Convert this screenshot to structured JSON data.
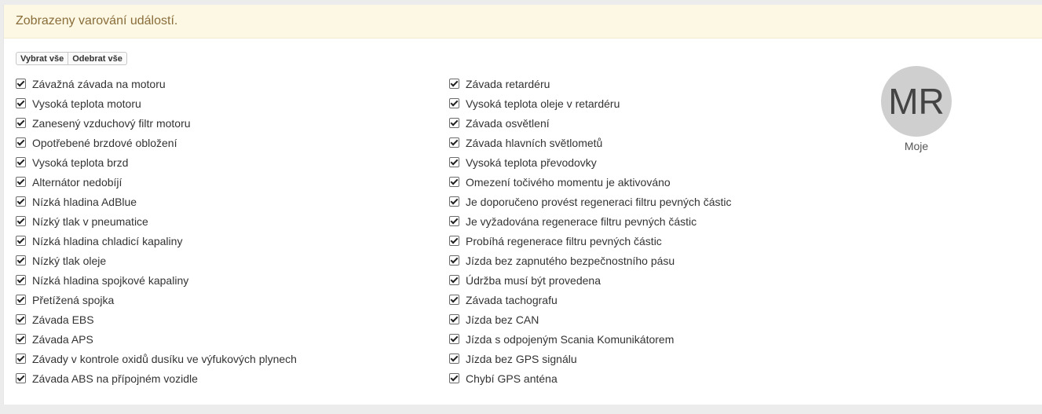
{
  "alert": {
    "text": "Zobrazeny varování událostí."
  },
  "toolbar": {
    "select_all_label": "Vybrat vše",
    "deselect_all_label": "Odebrat vše"
  },
  "left_items": [
    "Závažná závada na motoru",
    "Vysoká teplota motoru",
    "Zanesený vzduchový filtr motoru",
    "Opotřebené brzdové obložení",
    "Vysoká teplota brzd",
    "Alternátor nedobíjí",
    "Nízká hladina AdBlue",
    "Nízký tlak v pneumatice",
    "Nízká hladina chladicí kapaliny",
    "Nízký tlak oleje",
    "Nízká hladina spojkové kapaliny",
    "Přetížená spojka",
    "Závada EBS",
    "Závada APS",
    "Závady v kontrole oxidů dusíku ve výfukových plynech",
    "Závada ABS na přípojném vozidle"
  ],
  "right_items": [
    "Závada retardéru",
    "Vysoká teplota oleje v retardéru",
    "Závada osvětlení",
    "Závada hlavních světlometů",
    "Vysoká teplota převodovky",
    "Omezení točivého momentu je aktivováno",
    "Je doporučeno provést regeneraci filtru pevných částic",
    "Je vyžadována regenerace filtru pevných částic",
    "Probíhá regenerace filtru pevných částic",
    "Jízda bez zapnutého bezpečnostního pásu",
    "Údržba musí být provedena",
    "Závada tachografu",
    "Jízda bez CAN",
    "Jízda s odpojeným Scania Komunikátorem",
    "Jízda bez GPS signálu",
    "Chybí GPS anténa"
  ],
  "all_checked": true,
  "avatar": {
    "initials": "MR",
    "label": "Moje",
    "color": "#cfcfcf"
  }
}
